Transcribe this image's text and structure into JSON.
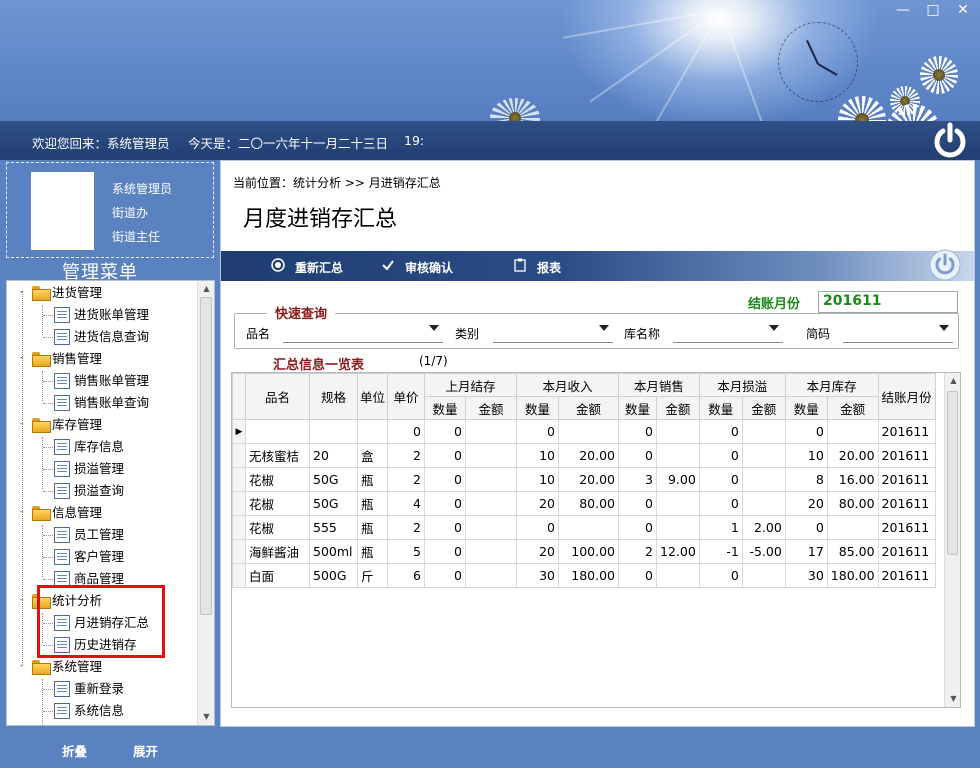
{
  "window": {
    "minimize": "—",
    "maximize": "□",
    "close": "✕"
  },
  "header": {
    "welcome": "欢迎您回来：系统管理员",
    "today": "今天是：二〇一六年十一月二十三日",
    "time": "19:"
  },
  "profile": {
    "name": "系统管理员",
    "org": "街道办",
    "role": "街道主任"
  },
  "menu": {
    "title": "管理菜单",
    "groups": [
      {
        "label": "进货管理",
        "items": [
          "进货账单管理",
          "进货信息查询"
        ]
      },
      {
        "label": "销售管理",
        "items": [
          "销售账单管理",
          "销售账单查询"
        ]
      },
      {
        "label": "库存管理",
        "items": [
          "库存信息",
          "损溢管理",
          "损溢查询"
        ]
      },
      {
        "label": "信息管理",
        "items": [
          "员工管理",
          "客户管理",
          "商品管理"
        ]
      },
      {
        "label": "统计分析",
        "items": [
          "月进销存汇总",
          "历史进销存"
        ]
      },
      {
        "label": "系统管理",
        "items": [
          "重新登录",
          "系统信息"
        ]
      }
    ]
  },
  "footer": {
    "collapse": "折叠",
    "expand": "展开"
  },
  "main": {
    "breadcrumb": "当前位置：统计分析 >> 月进销存汇总",
    "title": "月度进销存汇总",
    "toolbar": {
      "recalc": "重新汇总",
      "confirm": "审核确认",
      "report": "报表"
    },
    "quick_query": "快速查询",
    "month_label": "结账月份",
    "month_value": "201611",
    "filters": {
      "name": "品名",
      "category": "类别",
      "store": "库名称",
      "code": "简码"
    },
    "summary_title": "汇总信息一览表",
    "page_count": "(1/7)"
  },
  "table": {
    "headers": {
      "name": "品名",
      "spec": "规格",
      "unit": "单位",
      "price": "单价",
      "last_stock": "上月结存",
      "month_in": "本月收入",
      "month_sales": "本月销售",
      "month_loss": "本月损溢",
      "month_stock": "本月库存",
      "month": "结账月份",
      "qty": "数量",
      "amount": "金额"
    },
    "rows": [
      [
        "",
        "",
        "",
        "0",
        "0",
        "",
        "0",
        "",
        "0",
        "",
        "0",
        "",
        "0",
        "",
        "201611"
      ],
      [
        "无核蜜桔",
        "20",
        "盒",
        "2",
        "0",
        "",
        "10",
        "20.00",
        "0",
        "",
        "0",
        "",
        "10",
        "20.00",
        "201611"
      ],
      [
        "花椒",
        "50G",
        "瓶",
        "2",
        "0",
        "",
        "10",
        "20.00",
        "3",
        "9.00",
        "0",
        "",
        "8",
        "16.00",
        "201611"
      ],
      [
        "花椒",
        "50G",
        "瓶",
        "4",
        "0",
        "",
        "20",
        "80.00",
        "0",
        "",
        "0",
        "",
        "20",
        "80.00",
        "201611"
      ],
      [
        "花椒",
        "555",
        "瓶",
        "2",
        "0",
        "",
        "0",
        "",
        "0",
        "",
        "1",
        "2.00",
        "0",
        "",
        "201611"
      ],
      [
        "海鲜酱油",
        "500ml",
        "瓶",
        "5",
        "0",
        "",
        "20",
        "100.00",
        "2",
        "12.00",
        "-1",
        "-5.00",
        "17",
        "85.00",
        "201611"
      ],
      [
        "白面",
        "500G",
        "斤",
        "6",
        "0",
        "",
        "30",
        "180.00",
        "0",
        "",
        "0",
        "",
        "30",
        "180.00",
        "201611"
      ]
    ]
  },
  "colors": {
    "header_blue": "#5a82c0",
    "status_dark": "#213e72",
    "highlight_red": "#e01010",
    "accent_green": "#1a8a1a",
    "title_red": "#8b1a1a"
  },
  "icons": [
    "folder-icon",
    "page-icon",
    "clock-icon",
    "power-icon",
    "radio-icon",
    "check-icon",
    "clipboard-icon"
  ]
}
